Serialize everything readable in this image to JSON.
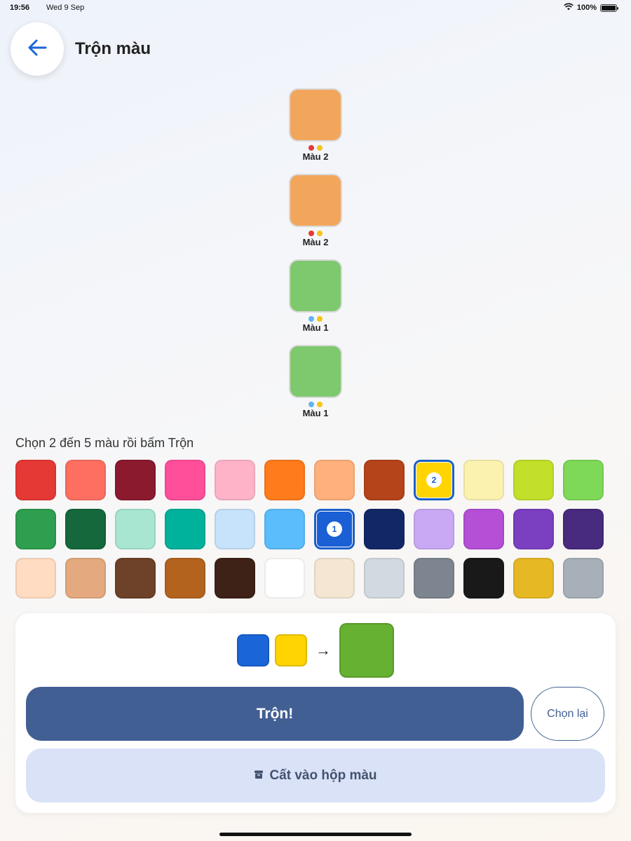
{
  "status": {
    "time": "19:56",
    "date": "Wed 9 Sep",
    "battery": "100%"
  },
  "header": {
    "title": "Trộn màu",
    "back_icon": "arrow-left-icon"
  },
  "stack": [
    {
      "color": "#f2a65c",
      "dots": [
        "#e53935",
        "#f5c518"
      ],
      "label": "Màu 2"
    },
    {
      "color": "#f2a65c",
      "dots": [
        "#e53935",
        "#f5c518"
      ],
      "label": "Màu 2"
    },
    {
      "color": "#7ec96e",
      "dots": [
        "#5eb5f0",
        "#f5c518"
      ],
      "label": "Màu 1"
    },
    {
      "color": "#7ec96e",
      "dots": [
        "#5eb5f0",
        "#f5c518"
      ],
      "label": "Màu 1"
    }
  ],
  "instruction": "Chọn 2 đến 5 màu rồi bấm Trộn",
  "palette": [
    {
      "color": "#e53935"
    },
    {
      "color": "#ff6f61"
    },
    {
      "color": "#8b1a2e"
    },
    {
      "color": "#ff4f9a"
    },
    {
      "color": "#ffb3c8"
    },
    {
      "color": "#ff7b1c"
    },
    {
      "color": "#ffb07c"
    },
    {
      "color": "#b5441a"
    },
    {
      "color": "#ffd400",
      "badge": "2",
      "selected": true
    },
    {
      "color": "#fcf2b0"
    },
    {
      "color": "#c2e02a"
    },
    {
      "color": "#7fd958"
    },
    {
      "color": "#2e9e4f"
    },
    {
      "color": "#14683c"
    },
    {
      "color": "#a8e6d2"
    },
    {
      "color": "#00b19c"
    },
    {
      "color": "#c7e2fb"
    },
    {
      "color": "#5bbdfb"
    },
    {
      "color": "#1a5fd4",
      "badge": "1",
      "selected": true
    },
    {
      "color": "#122866"
    },
    {
      "color": "#c9a9f3"
    },
    {
      "color": "#b44fd6"
    },
    {
      "color": "#7b3fc2"
    },
    {
      "color": "#482a7e"
    },
    {
      "color": "#ffdcc2"
    },
    {
      "color": "#e4a97e"
    },
    {
      "color": "#6e4228"
    },
    {
      "color": "#b4631f"
    },
    {
      "color": "#3e2217"
    },
    {
      "color": "#ffffff"
    },
    {
      "color": "#f5e6d3"
    },
    {
      "color": "#d3d9e0"
    },
    {
      "color": "#7d8690"
    },
    {
      "color": "#191919"
    },
    {
      "color": "#e6b824"
    },
    {
      "color": "#a7b0b9"
    }
  ],
  "preview": {
    "inputs": [
      "#1a66d9",
      "#ffd400"
    ],
    "arrow": "→",
    "result": "#66b032"
  },
  "buttons": {
    "mix": "Trộn!",
    "reset": "Chọn lại",
    "save": "Cất vào hộp màu",
    "save_icon": "archive-box-icon"
  },
  "colors": {
    "accent": "#425f94",
    "save_bg": "#d9e2f7"
  }
}
